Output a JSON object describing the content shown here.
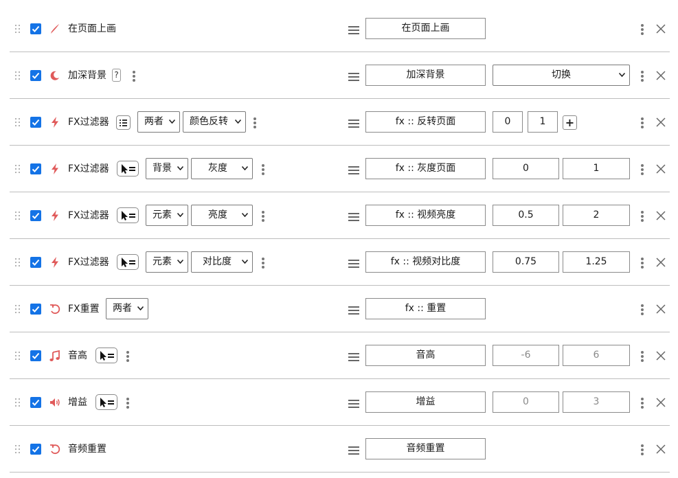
{
  "rows": [
    {
      "label": "在页面上画",
      "action": "在页面上画"
    },
    {
      "label": "加深背景",
      "help": "?",
      "action": "加深背景",
      "select": "切换"
    },
    {
      "label": "FX过滤器",
      "target": "两者",
      "filter": "颜色反转",
      "action": "fx :: 反转页面",
      "from": "0",
      "to": "1"
    },
    {
      "label": "FX过滤器",
      "target": "背景",
      "filter": "灰度",
      "action": "fx :: 灰度页面",
      "from": "0",
      "to": "1"
    },
    {
      "label": "FX过滤器",
      "target": "元素",
      "filter": "亮度",
      "action": "fx :: 视频亮度",
      "from": "0.5",
      "to": "2"
    },
    {
      "label": "FX过滤器",
      "target": "元素",
      "filter": "对比度",
      "action": "fx :: 视频对比度",
      "from": "0.75",
      "to": "1.25"
    },
    {
      "label": "FX重置",
      "target": "两者",
      "action": "fx :: 重置"
    },
    {
      "label": "音高",
      "action": "音高",
      "from": "-6",
      "to": "6"
    },
    {
      "label": "增益",
      "action": "增益",
      "from": "0",
      "to": "3"
    },
    {
      "label": "音频重置",
      "action": "音频重置"
    }
  ],
  "icons": {
    "drag": "drag-handle-icon",
    "check": "checkbox-checked-icon",
    "draw": "brush-icon",
    "darken": "moon-icon",
    "fx": "lightning-icon",
    "reset": "reset-icon",
    "pitch": "music-note-icon",
    "gain": "volume-icon",
    "more": "kebab-menu-icon",
    "delete": "close-icon",
    "reorder": "hamburger-icon",
    "list": "list-icon",
    "picker": "element-picker-icon",
    "add": "plus-icon"
  },
  "colors": {
    "accent": "#1473e6",
    "icon_red": "#e05a5a",
    "border": "#bdbdbd"
  }
}
